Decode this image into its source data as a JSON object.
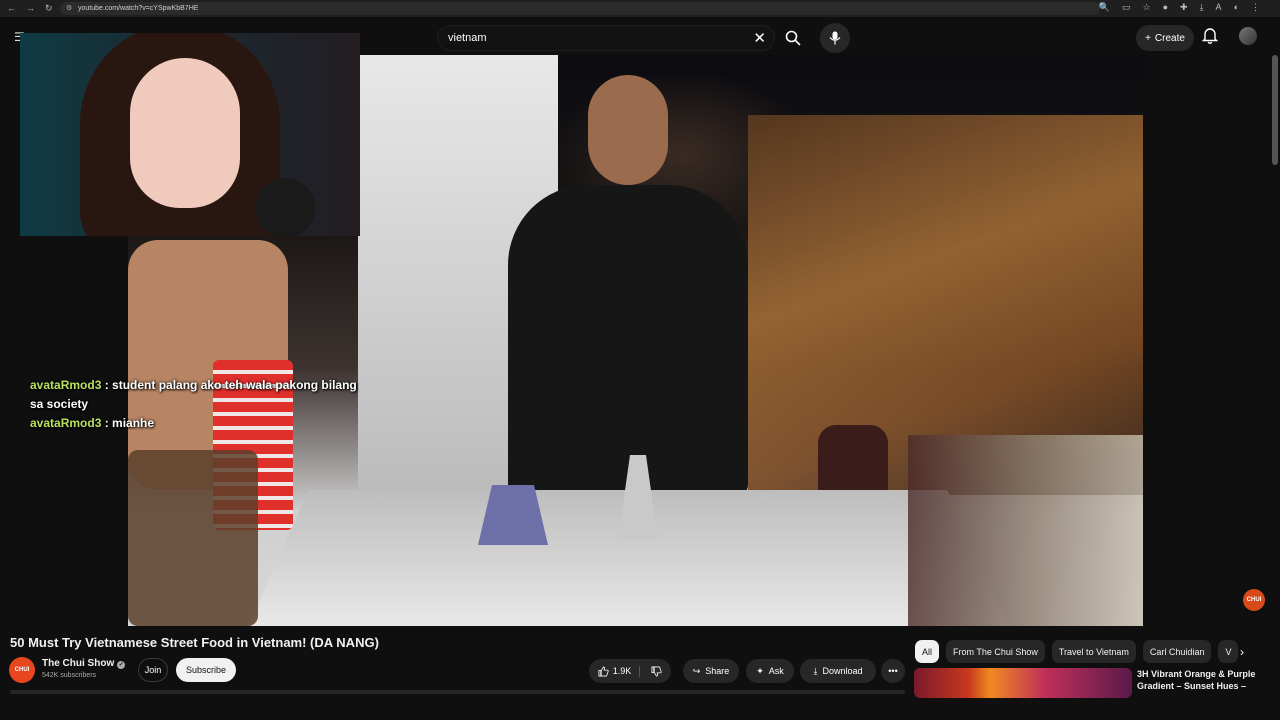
{
  "browser": {
    "url": "youtube.com/watch?v=cYSpwKbB7HE"
  },
  "header": {
    "search_value": "vietnam",
    "create_label": "Create"
  },
  "chat": [
    {
      "user": "avataRmod3",
      "message": "student palang ako teh wala pakong bilang sa society"
    },
    {
      "user": "avataRmod3",
      "message": "mianhe"
    }
  ],
  "video": {
    "title": "50 Must Try Vietnamese Street Food in Vietnam! (DA NANG)",
    "channel_name": "The Chui Show",
    "channel_logo": "CHUI",
    "subscribers": "542K subscribers",
    "join_label": "Join",
    "subscribe_label": "Subscribe",
    "likes": "1.9K",
    "share_label": "Share",
    "ask_label": "Ask",
    "download_label": "Download"
  },
  "chips": [
    "All",
    "From The Chui Show",
    "Travel to Vietnam",
    "Carl Chuidian",
    "V"
  ],
  "recommendation": {
    "title": "3H Vibrant Orange & Purple Gradient – Sunset Hues –"
  },
  "colors": {
    "background": "#0f0f0f",
    "chat_username": "#b8e060",
    "brand_orange": "#e8461e"
  }
}
